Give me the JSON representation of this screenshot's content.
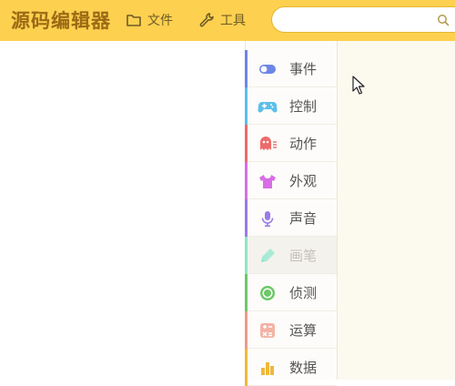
{
  "app": {
    "logo": "源码编辑器"
  },
  "toolbar": {
    "file_label": "文件",
    "tools_label": "工具"
  },
  "search": {
    "placeholder": ""
  },
  "categories": [
    {
      "label": "事件",
      "icon": "toggle-icon",
      "color": "#6d86e6",
      "disabled": false
    },
    {
      "label": "控制",
      "icon": "gamepad-icon",
      "color": "#5bbfec",
      "disabled": false
    },
    {
      "label": "动作",
      "icon": "ghost-icon",
      "color": "#ec6a6a",
      "disabled": false
    },
    {
      "label": "外观",
      "icon": "shirt-icon",
      "color": "#d86ee6",
      "disabled": false
    },
    {
      "label": "声音",
      "icon": "microphone-icon",
      "color": "#9a7be8",
      "disabled": false
    },
    {
      "label": "画笔",
      "icon": "pen-icon",
      "color": "#8ee6c8",
      "disabled": true
    },
    {
      "label": "侦测",
      "icon": "radar-icon",
      "color": "#6cc868",
      "disabled": false
    },
    {
      "label": "运算",
      "icon": "calculator-icon",
      "color": "#f09a8a",
      "disabled": false
    },
    {
      "label": "数据",
      "icon": "bar-chart-icon",
      "color": "#f0b83a",
      "disabled": false
    }
  ],
  "colors": {
    "topbar": "#fdd04f",
    "logo": "#9b6a14"
  }
}
